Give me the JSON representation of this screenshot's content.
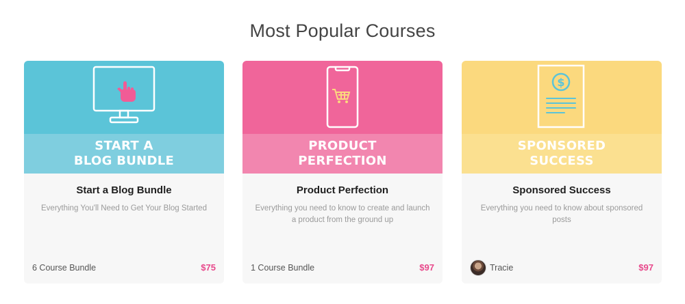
{
  "section": {
    "title": "Most Popular Courses"
  },
  "cards": [
    {
      "banner": [
        "START A",
        "BLOG BUNDLE"
      ],
      "title": "Start a Blog Bundle",
      "description": "Everything You'll Need to Get Your Blog Started",
      "footer_text": "6 Course Bundle",
      "price": "$75",
      "icon": "monitor-hand-icon",
      "colors": {
        "top": "#5bc4d8",
        "band": "#7fcedf",
        "accent": "#f15c96"
      }
    },
    {
      "banner": [
        "PRODUCT",
        "PERFECTION"
      ],
      "title": "Product Perfection",
      "description": "Everything you need to know to create and launch a product from the ground up",
      "footer_text": "1 Course Bundle",
      "price": "$97",
      "icon": "phone-cart-icon",
      "colors": {
        "top": "#f0659a",
        "band": "#f286af",
        "accent": "#fbd97e"
      }
    },
    {
      "banner": [
        "SPONSORED",
        "SUCCESS"
      ],
      "title": "Sponsored Success",
      "description": "Everything you need to know about sponsored posts",
      "author": "Tracie",
      "price": "$97",
      "icon": "dollar-document-icon",
      "colors": {
        "top": "#fbd97e",
        "band": "#fbe090",
        "accent": "#5bc4d8"
      }
    }
  ]
}
